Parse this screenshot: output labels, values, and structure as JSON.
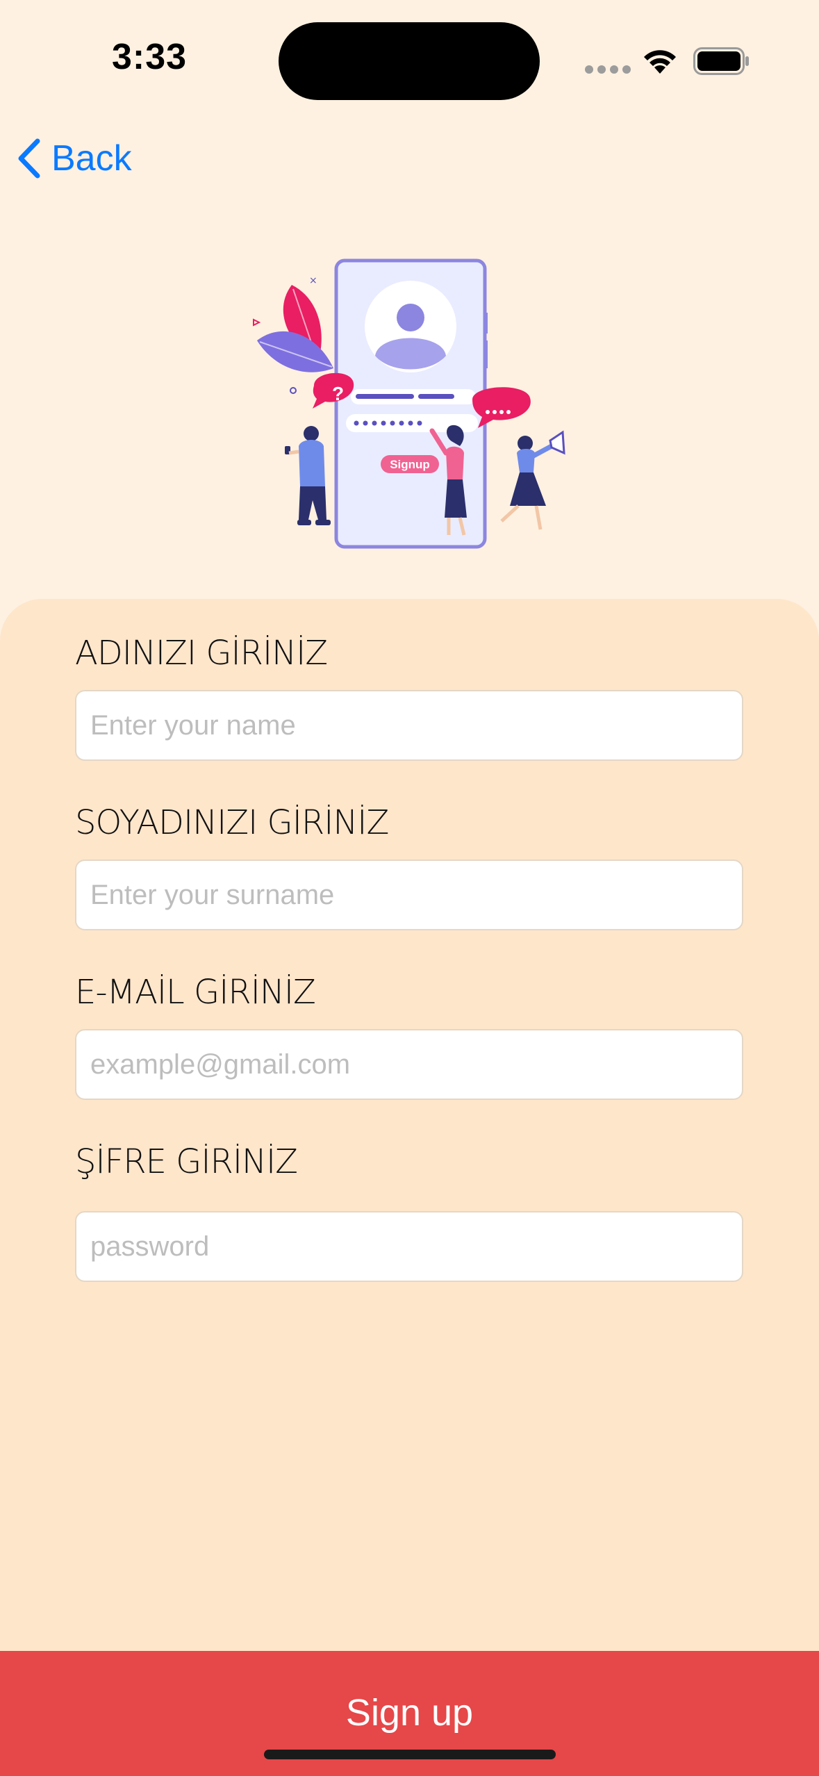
{
  "status_bar": {
    "time": "3:33"
  },
  "nav": {
    "back_label": "Back"
  },
  "illustration": {
    "button_text": "Signup"
  },
  "form": {
    "fields": [
      {
        "label": "ADINIZI GİRİNİZ",
        "placeholder": "Enter your name",
        "value": ""
      },
      {
        "label": "SOYADINIZI GİRİNİZ",
        "placeholder": "Enter your surname",
        "value": ""
      },
      {
        "label": "E-MAİL GİRİNİZ",
        "placeholder": "example@gmail.com",
        "value": ""
      },
      {
        "label": "ŞİFRE GİRİNİZ",
        "placeholder": "password",
        "value": ""
      }
    ]
  },
  "signup_button": {
    "label": "Sign up"
  },
  "colors": {
    "background": "#FEF1E1",
    "form_background": "#FEE6CB",
    "accent": "#0A7AFF",
    "button": "#E64749"
  }
}
